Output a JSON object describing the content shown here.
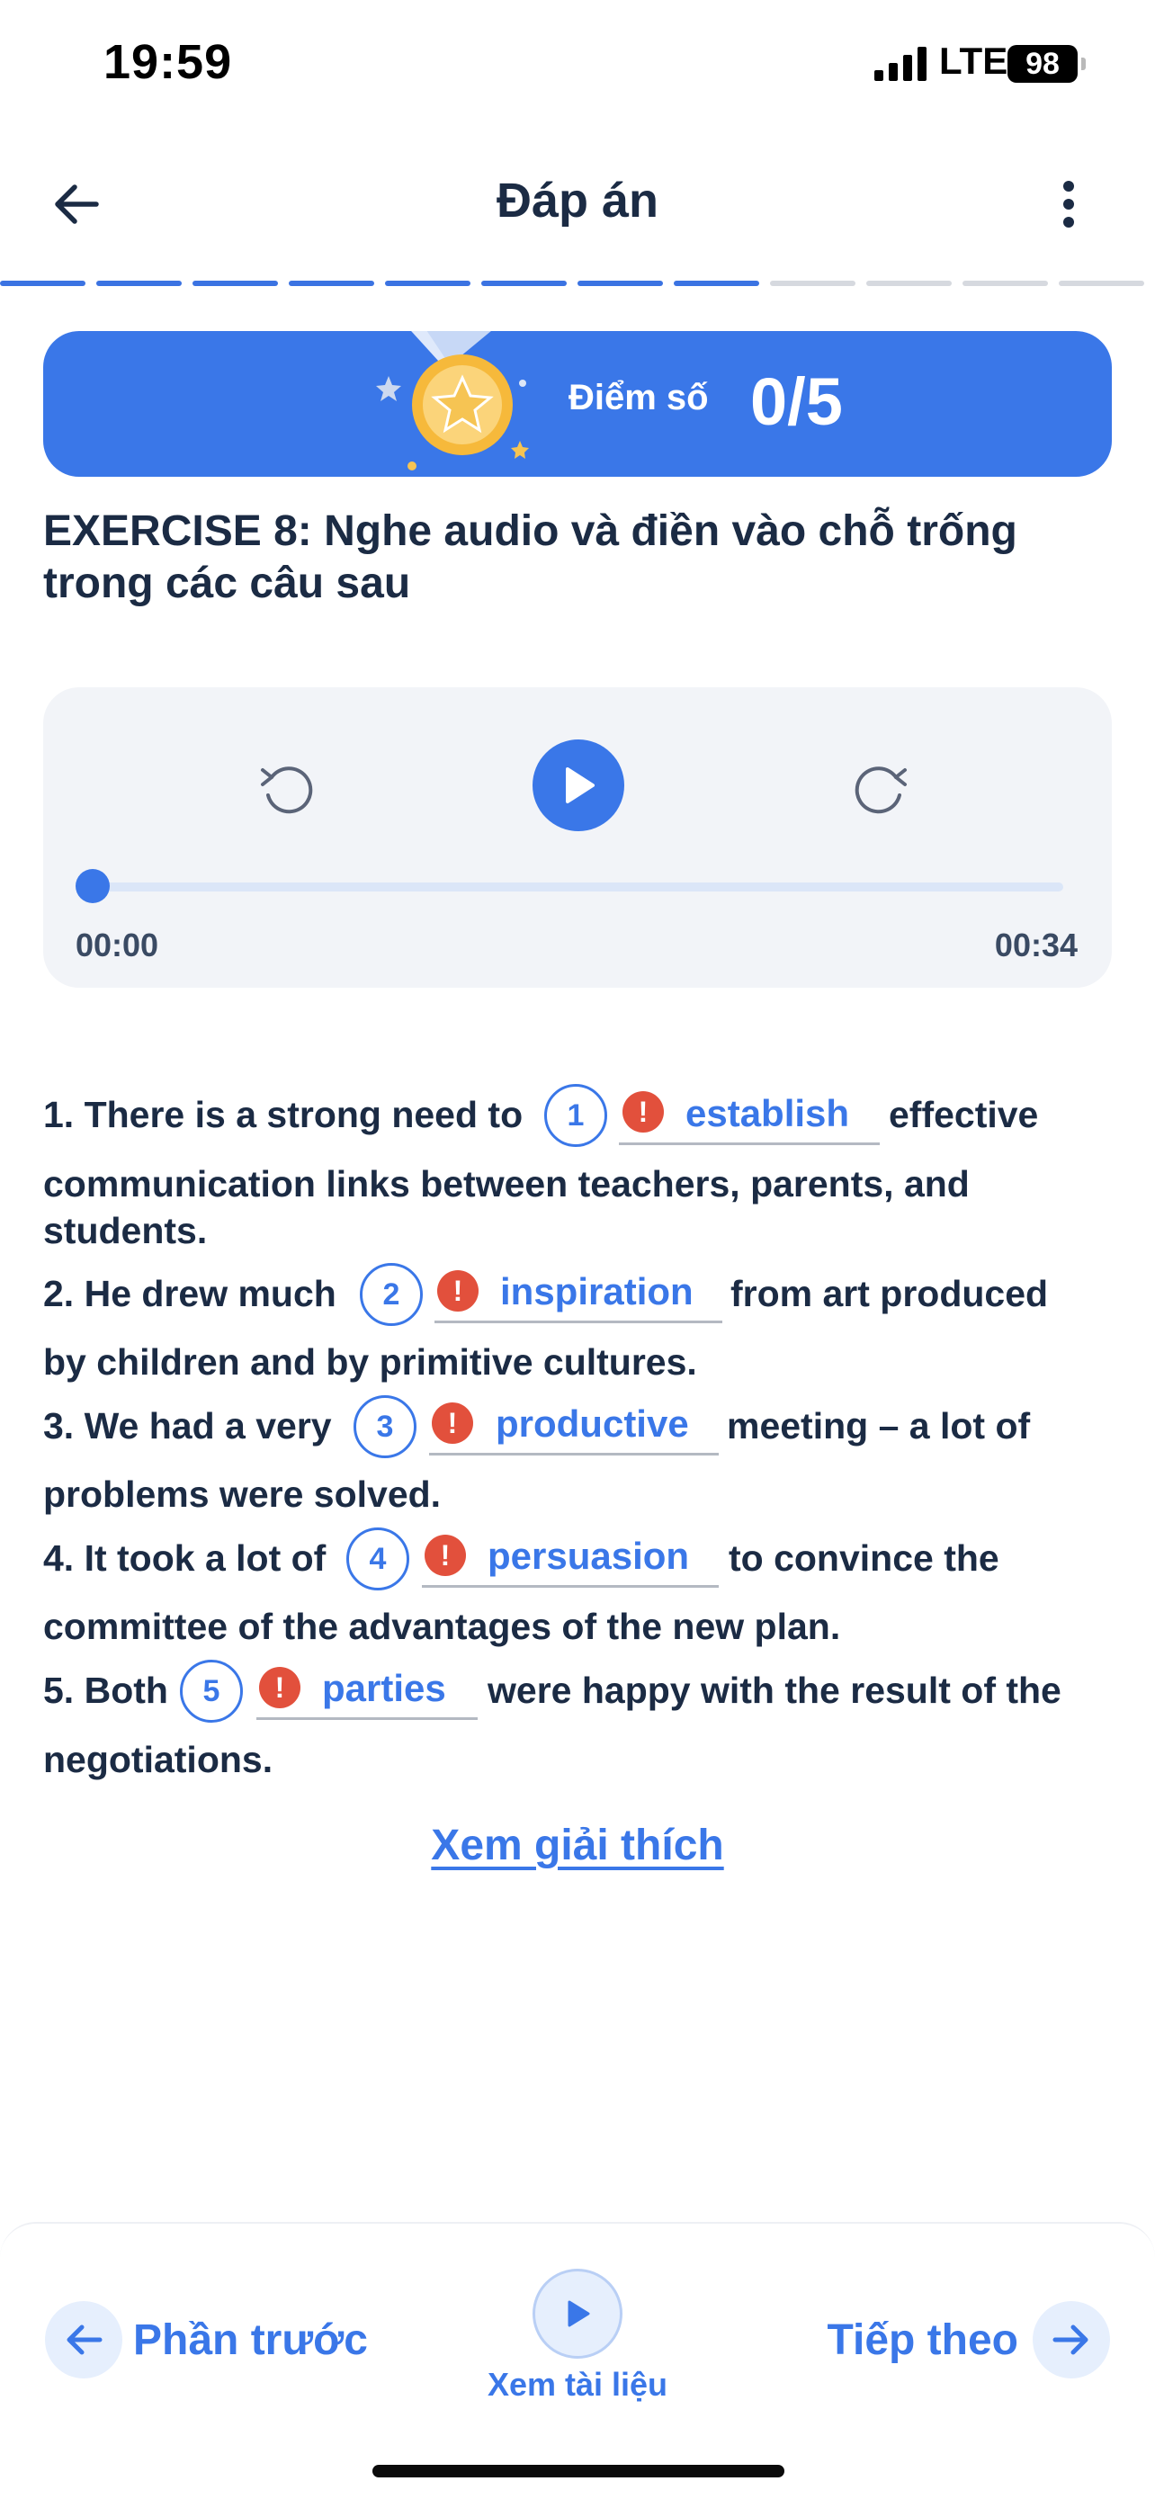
{
  "status_bar": {
    "time": "19:59",
    "network": "LTE",
    "battery": "98"
  },
  "header": {
    "title": "Đáp án"
  },
  "progress": {
    "total_segments": 12,
    "completed_segments": 8
  },
  "score": {
    "label": "Điểm số",
    "value": "0/5"
  },
  "exercise": {
    "title": "EXERCISE 8: Nghe audio và điền vào chỗ trống trong các câu sau"
  },
  "player": {
    "current_time": "00:00",
    "duration": "00:34",
    "progress": 0
  },
  "sentences": [
    {
      "prefix": "1. There is a strong need to",
      "number": "1",
      "answer": "establish",
      "suffix": "effective",
      "cont1": "communication links between teachers, parents, and",
      "cont2": "students."
    },
    {
      "prefix": "2. He drew much",
      "number": "2",
      "answer": "inspiration",
      "suffix": "from art produced",
      "cont1": "by children and by primitive cultures."
    },
    {
      "prefix": "3. We had a very",
      "number": "3",
      "answer": "productive",
      "suffix": "meeting – a lot of",
      "cont1": "problems were solved."
    },
    {
      "prefix": "4. It took a lot of",
      "number": "4",
      "answer": "persuasion",
      "suffix": "to convince the",
      "cont1": "committee of the advantages of the new plan."
    },
    {
      "prefix": "5. Both",
      "number": "5",
      "answer": "parties",
      "suffix": "were happy with the result of the",
      "cont1": "negotiations."
    }
  ],
  "warning_mark": "!",
  "explain_link": "Xem giải thích",
  "bottom_nav": {
    "prev_label": "Phần trước",
    "doc_label": "Xem tài liệu",
    "next_label": "Tiếp theo"
  },
  "colors": {
    "accent": "#3a77e8",
    "error": "#e2503c",
    "text": "#1b2b44"
  }
}
